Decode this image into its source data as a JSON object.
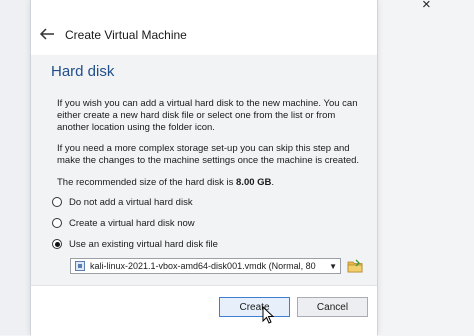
{
  "window": {
    "title": "Create Virtual Machine",
    "close_glyph": "×"
  },
  "page": {
    "heading": "Hard disk",
    "paragraph1": "If you wish you can add a virtual hard disk to the new machine. You can either create a new hard disk file or select one from the list or from another location using the folder icon.",
    "paragraph2": "If you need a more complex storage set-up you can skip this step and make the changes to the machine settings once the machine is created.",
    "recommended_prefix": "The recommended size of the hard disk is ",
    "recommended_size": "8.00 GB",
    "recommended_suffix": "."
  },
  "options": [
    {
      "label": "Do not add a virtual hard disk",
      "checked": false
    },
    {
      "label": "Create a virtual hard disk now",
      "checked": false
    },
    {
      "label": "Use an existing virtual hard disk file",
      "checked": true
    }
  ],
  "disk_select": {
    "value": "kali-linux-2021.1-vbox-amd64-disk001.vmdk (Normal, 80",
    "icon": "hard-disk-icon"
  },
  "buttons": {
    "create": "Create",
    "cancel": "Cancel"
  },
  "icons": {
    "back": "back-arrow-icon",
    "folder": "folder-icon"
  },
  "colors": {
    "heading": "#1f4e8a",
    "focus_border": "#3c7fd1",
    "folder": "#e8b84a"
  }
}
